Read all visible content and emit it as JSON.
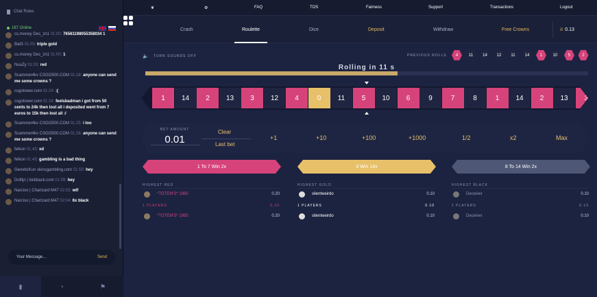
{
  "sidebar": {
    "title": "Chat Rules",
    "online": "167 Online",
    "messages": [
      {
        "user": "cs.money Des_zn1",
        "time": "01:00:",
        "text": "76561198055358034 1"
      },
      {
        "user": "BatS",
        "time": "01:00:",
        "text": "triple gold"
      },
      {
        "user": "cs.money Des_zn1",
        "time": "01:00:",
        "text": "1"
      },
      {
        "user": "NuuZy",
        "time": "01:03:",
        "text": "red"
      },
      {
        "user": "Scammer4kv CSGO500.COM",
        "time": "01:18:",
        "text": "anyone can send me some crowns ?"
      },
      {
        "user": "csgotower.com",
        "time": "01:24:",
        "text": ":("
      },
      {
        "user": "csgotower.com",
        "time": "01:24:",
        "text": "feelsbadman i got from 50 cents to 24k then lost all i deposited went from 7 euros to 15k then lost all :/"
      },
      {
        "user": "Scammer4kv CSGO500.COM",
        "time": "01:25:",
        "text": "i too"
      },
      {
        "user": "Scammer4kv CSGO500.COM",
        "time": "01:28:",
        "text": "anyone can send me some crowns ?"
      },
      {
        "user": "felkon",
        "time": "01:43:",
        "text": "xd"
      },
      {
        "user": "felkon",
        "time": "01:43:",
        "text": "gambling is a bad thing"
      },
      {
        "user": "GeneticKun skinsgambling.com",
        "time": "01:59:",
        "text": "hey"
      },
      {
        "user": "Dolfijn | kickback.com",
        "time": "01:59:",
        "text": "hey"
      },
      {
        "user": "Narciso | Charizard M47",
        "time": "02:03:",
        "text": "wtf"
      },
      {
        "user": "Narciso | Charizard M47",
        "time": "02:04:",
        "text": "6x black"
      }
    ],
    "input_placeholder": "Your Message...",
    "send_label": "Send"
  },
  "topnav": [
    "FAQ",
    "TOS",
    "Fairness",
    "Support",
    "Transactions",
    "Logout"
  ],
  "gamenav": {
    "items": [
      "Crash",
      "Roulette",
      "Dice",
      "Deposit",
      "Withdraw",
      "Free Crowns"
    ],
    "balance": "0.13"
  },
  "sounds_label": "TURN SOUNDS OFF",
  "previous_label": "PREVIOUS ROLLS",
  "previous_rolls": [
    {
      "n": "4",
      "c": "red"
    },
    {
      "n": "11",
      "c": "black"
    },
    {
      "n": "14",
      "c": "black"
    },
    {
      "n": "12",
      "c": "black"
    },
    {
      "n": "11",
      "c": "black"
    },
    {
      "n": "14",
      "c": "black"
    },
    {
      "n": "1",
      "c": "red"
    },
    {
      "n": "10",
      "c": "black"
    },
    {
      "n": "5",
      "c": "red"
    },
    {
      "n": "2",
      "c": "red"
    }
  ],
  "rolling_text": "Rolling in 11 s",
  "progress": 0.57,
  "strip": [
    {
      "n": "1",
      "c": "red"
    },
    {
      "n": "14",
      "c": "black"
    },
    {
      "n": "2",
      "c": "red"
    },
    {
      "n": "13",
      "c": "black"
    },
    {
      "n": "3",
      "c": "red"
    },
    {
      "n": "12",
      "c": "black"
    },
    {
      "n": "4",
      "c": "red"
    },
    {
      "n": "0",
      "c": "gold"
    },
    {
      "n": "11",
      "c": "black"
    },
    {
      "n": "5",
      "c": "red"
    },
    {
      "n": "10",
      "c": "black"
    },
    {
      "n": "6",
      "c": "red"
    },
    {
      "n": "9",
      "c": "black"
    },
    {
      "n": "7",
      "c": "red"
    },
    {
      "n": "8",
      "c": "black"
    },
    {
      "n": "1",
      "c": "red"
    },
    {
      "n": "14",
      "c": "black"
    },
    {
      "n": "2",
      "c": "red"
    },
    {
      "n": "13",
      "c": "black"
    },
    {
      "n": "3",
      "c": "red"
    }
  ],
  "bet": {
    "label": "BET AMOUNT",
    "value": "0.01",
    "clear": "Clear",
    "last_bet": "Last bet",
    "buttons": [
      "+1",
      "+10",
      "+100",
      "+1000",
      "1/2",
      "x2",
      "Max"
    ]
  },
  "columns": [
    {
      "title": "1 To 7 Win 2x",
      "highest_label": "HIGHEST RED",
      "highest_name": "*TOTEM'S* 1985",
      "highest_amt": "0.20",
      "players": "1 PLAYERS",
      "players_total": "0.20",
      "entry_name": "*TOTEM'S* 1985",
      "entry_amt": "0.20"
    },
    {
      "title": "0 Win 14x",
      "highest_label": "HIGHEST GOLD",
      "highest_name": "silentweirdo",
      "highest_amt": "0.10",
      "players": "1 PLAYERS",
      "players_total": "0.10",
      "entry_name": "silentweirdo",
      "entry_amt": "0.10"
    },
    {
      "title": "8 To 14 Win 2x",
      "highest_label": "HIGHEST BLACK",
      "highest_name": "Deceiver",
      "highest_amt": "0.10",
      "players": "1 PLAYERS",
      "players_total": "0.10",
      "entry_name": "Deceiver",
      "entry_amt": "0.10"
    }
  ]
}
